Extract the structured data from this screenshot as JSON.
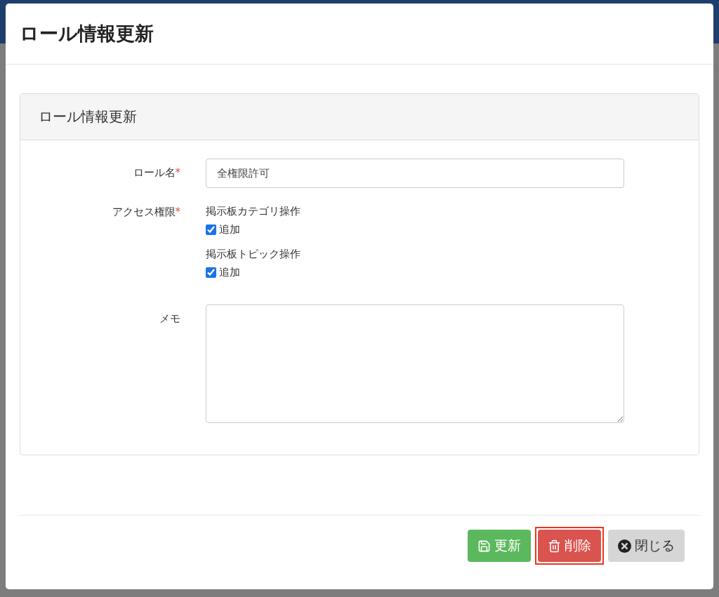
{
  "modal": {
    "title": "ロール情報更新"
  },
  "panel": {
    "title": "ロール情報更新",
    "fields": [
      {
        "kind": "text",
        "label": "ロール名",
        "required_mark": "*",
        "value": "全権限許可"
      },
      {
        "kind": "permissions",
        "label": "アクセス権限",
        "required_mark": "*",
        "groups": [
          {
            "title": "掲示板カテゴリ操作",
            "options": [
              {
                "label": "追加",
                "checked": true
              }
            ]
          },
          {
            "title": "掲示板トピック操作",
            "options": [
              {
                "label": "追加",
                "checked": true
              }
            ]
          }
        ]
      },
      {
        "kind": "textarea",
        "label": "メモ"
      }
    ]
  },
  "buttons": [
    {
      "kind": "update",
      "label": "更新",
      "highlighted": false
    },
    {
      "kind": "delete",
      "label": "削除",
      "highlighted": true
    },
    {
      "kind": "close",
      "label": "閉じる",
      "highlighted": false
    }
  ]
}
